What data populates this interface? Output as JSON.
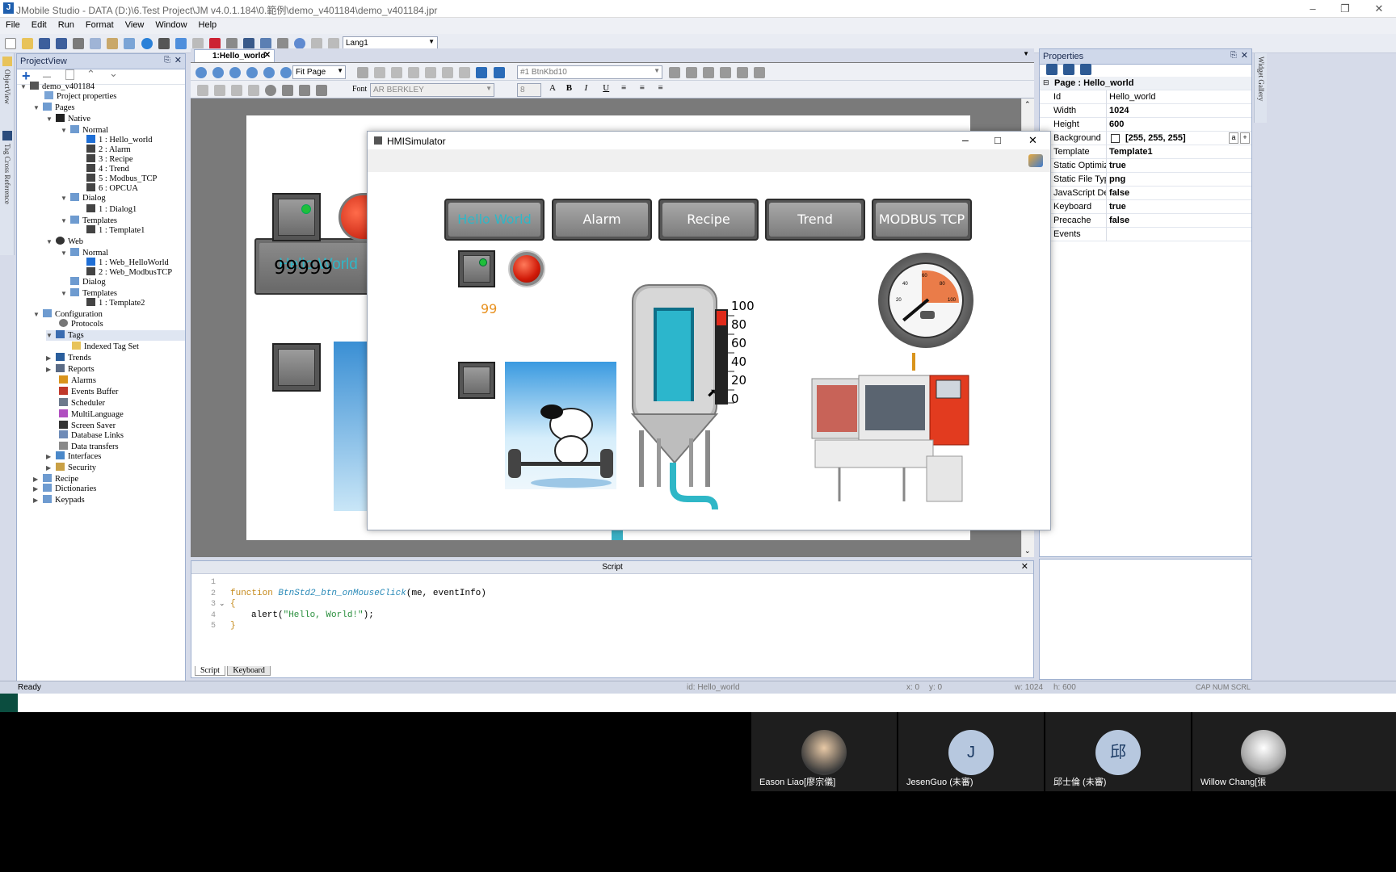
{
  "window": {
    "title": "JMobile Studio - DATA (D:)\\6.Test Project\\JM v4.0.1.184\\0.範例\\demo_v401184\\demo_v401184.jpr",
    "app_icon": "J"
  },
  "menu": [
    "File",
    "Edit",
    "Run",
    "Format",
    "View",
    "Window",
    "Help"
  ],
  "toolbar": {
    "language": "Lang1"
  },
  "side_tabs": {
    "objectview": "ObjectView",
    "tagxref": "Tag Cross Reference"
  },
  "projectview": {
    "title": "ProjectView",
    "items": [
      {
        "label": "demo_v401184"
      },
      {
        "label": "Project properties"
      },
      {
        "label": "Pages"
      },
      {
        "label": "Native"
      },
      {
        "label": "Normal"
      },
      {
        "label": "1 : Hello_world"
      },
      {
        "label": "2 : Alarm"
      },
      {
        "label": "3 : Recipe"
      },
      {
        "label": "4 : Trend"
      },
      {
        "label": "5 : Modbus_TCP"
      },
      {
        "label": "6 : OPCUA"
      },
      {
        "label": "Dialog"
      },
      {
        "label": "1 : Dialog1"
      },
      {
        "label": "Templates"
      },
      {
        "label": "1 : Template1"
      },
      {
        "label": "Web"
      },
      {
        "label": "Normal"
      },
      {
        "label": "1 : Web_HelloWorld"
      },
      {
        "label": "2 : Web_ModbusTCP"
      },
      {
        "label": "Dialog"
      },
      {
        "label": "Templates"
      },
      {
        "label": "1 : Template2"
      },
      {
        "label": "Configuration"
      },
      {
        "label": "Protocols"
      },
      {
        "label": "Tags"
      },
      {
        "label": "Indexed Tag Set"
      },
      {
        "label": "Trends"
      },
      {
        "label": "Reports"
      },
      {
        "label": "Alarms"
      },
      {
        "label": "Events Buffer"
      },
      {
        "label": "Scheduler"
      },
      {
        "label": "MultiLanguage"
      },
      {
        "label": "Screen Saver"
      },
      {
        "label": "Database Links"
      },
      {
        "label": "Data transfers"
      },
      {
        "label": "Interfaces"
      },
      {
        "label": "Security"
      },
      {
        "label": "Recipe"
      },
      {
        "label": "Dictionaries"
      },
      {
        "label": "Keypads"
      }
    ]
  },
  "editor": {
    "tab": "1:Hello_world",
    "zoom": "Fit Page",
    "widget_select": "#1 BtnKbd10",
    "font_label": "Font",
    "font": "AR BERKLEY",
    "font_size": "8",
    "canvas": {
      "nav_label": "Hello World",
      "value": "99999"
    }
  },
  "simulator": {
    "title": "HMISimulator",
    "nav": [
      "Hello World",
      "Alarm",
      "Recipe",
      "Trend",
      "MODBUS TCP"
    ],
    "value": "99",
    "tank_scale": [
      "100",
      "80",
      "60",
      "40",
      "20",
      "0"
    ],
    "gauge_ticks": [
      "20",
      "40",
      "60",
      "80",
      "100"
    ]
  },
  "properties": {
    "title": "Properties",
    "section": "Page : Hello_world",
    "rows": [
      {
        "key": "Id",
        "value": "Hello_world",
        "bold": false
      },
      {
        "key": "Width",
        "value": "1024"
      },
      {
        "key": "Height",
        "value": "600"
      },
      {
        "key": "Background",
        "value": "[255, 255, 255]"
      },
      {
        "key": "Template",
        "value": "Template1"
      },
      {
        "key": "Static Optimiza",
        "value": "true"
      },
      {
        "key": "Static File Typ",
        "value": "png"
      },
      {
        "key": "JavaScript Deb",
        "value": "false"
      },
      {
        "key": "Keyboard",
        "value": "true"
      },
      {
        "key": "Precache",
        "value": "false"
      },
      {
        "key": "Events",
        "value": ""
      }
    ],
    "bg_btn_a": "a",
    "bg_btn_plus": "+",
    "gallery_tab": "Widget Gallery"
  },
  "script": {
    "title": "Script",
    "lines": [
      "1",
      "2",
      "3",
      "4",
      "5"
    ],
    "code": {
      "kw": "function",
      "fn": "BtnStd2_btn_onMouseClick",
      "args": "(me, eventInfo)",
      "open": "{",
      "alert_pre": "alert(",
      "alert_str": "\"Hello, World!\"",
      "alert_post": ");",
      "close": "}"
    },
    "tabs": [
      "Script",
      "Keyboard"
    ]
  },
  "status": {
    "ready": "Ready",
    "id": "id:  Hello_world",
    "x": "x:  0",
    "y": "y:  0",
    "w": "w:  1024",
    "h": "h:  600",
    "keys": "CAP  NUM  SCRL"
  },
  "meeting": {
    "participants": [
      {
        "name": "Eason Liao[廖宗儀]",
        "initial": ""
      },
      {
        "name": "JesenGuo (未審)",
        "initial": "J"
      },
      {
        "name": "邱士倫 (未審)",
        "initial": "邱"
      },
      {
        "name": "Willow Chang[張",
        "initial": ""
      }
    ]
  },
  "colors": {
    "accent": "#2fb7c7",
    "value_orange": "#e8911f",
    "led_green": "#1fbf3a",
    "lamp_red": "#e02a1a"
  }
}
